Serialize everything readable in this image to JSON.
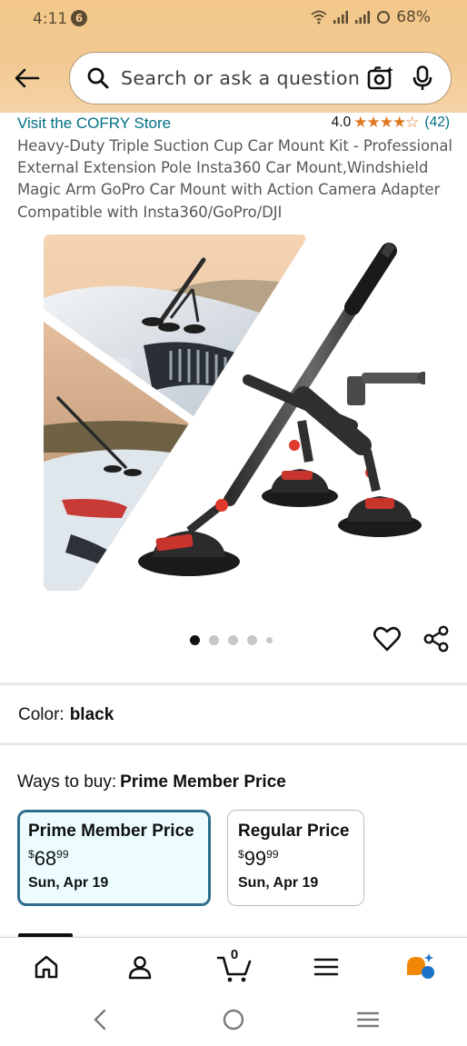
{
  "status_bar": {
    "time": "4:11",
    "notification_count": "6",
    "battery": "68%"
  },
  "search": {
    "placeholder": "Search or ask a question"
  },
  "product": {
    "store_link": "Visit the COFRY Store",
    "rating_value": "4.0",
    "rating_stars": "★★★★☆",
    "rating_count": "(42)",
    "title": "Heavy-Duty Triple Suction Cup Car Mount Kit - Professional External Extension Pole Insta360 Car Mount,Windshield Magic Arm GoPro Car Mount with Action Camera Adapter Compatible with Insta360/GoPro/DJI",
    "image_count": 5,
    "active_image_index": 0
  },
  "color": {
    "label": "Color:",
    "value": "black"
  },
  "ways_to_buy": {
    "label": "Ways to buy:",
    "selected": "Prime Member Price",
    "options": [
      {
        "name": "Prime Member Price",
        "currency": "$",
        "dollars": "68",
        "cents": "99",
        "date": "Sun, Apr 19",
        "selected": true
      },
      {
        "name": "Regular Price",
        "currency": "$",
        "dollars": "99",
        "cents": "99",
        "date": "Sun, Apr 19",
        "selected": false
      }
    ]
  },
  "bottom_nav": {
    "items": [
      "home-icon",
      "account-icon",
      "cart-icon",
      "menu-icon",
      "rufus-icon"
    ],
    "cart_count": "0"
  },
  "colors": {
    "link": "#007185",
    "star": "#de7921",
    "selected_border": "#2f6e8c",
    "header_gradient": "#f2c992"
  }
}
